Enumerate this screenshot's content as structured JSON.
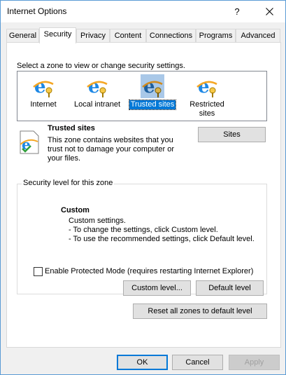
{
  "window": {
    "title": "Internet Options",
    "help_label": "?"
  },
  "tabs": [
    {
      "label": "General"
    },
    {
      "label": "Security"
    },
    {
      "label": "Privacy"
    },
    {
      "label": "Content"
    },
    {
      "label": "Connections"
    },
    {
      "label": "Programs"
    },
    {
      "label": "Advanced"
    }
  ],
  "active_tab": "Security",
  "zones": {
    "prompt": "Select a zone to view or change security settings.",
    "items": [
      {
        "label": "Internet",
        "icon": "internet-zone-icon"
      },
      {
        "label": "Local intranet",
        "icon": "local-intranet-zone-icon"
      },
      {
        "label": "Trusted sites",
        "icon": "trusted-sites-zone-icon",
        "selected": true
      },
      {
        "label": "Restricted sites",
        "icon": "restricted-sites-zone-icon"
      }
    ]
  },
  "zone_info": {
    "title": "Trusted sites",
    "description": [
      "This zone contains websites that you",
      "trust not to damage your computer or",
      "your files."
    ],
    "sites_button": "Sites"
  },
  "security_level": {
    "group_title": "Security level for this zone",
    "level_title": "Custom",
    "lines": [
      "Custom settings.",
      "- To change the settings, click Custom level.",
      "- To use the recommended settings, click Default level."
    ],
    "protected_mode_label": "Enable Protected Mode (requires restarting Internet Explorer)",
    "protected_mode_checked": false,
    "custom_level_button": "Custom level...",
    "default_level_button": "Default level"
  },
  "reset_button": "Reset all zones to default level",
  "footer": {
    "ok": "OK",
    "cancel": "Cancel",
    "apply": "Apply"
  },
  "colors": {
    "accent": "#0078d7",
    "window_border": "#5a9bd5"
  }
}
